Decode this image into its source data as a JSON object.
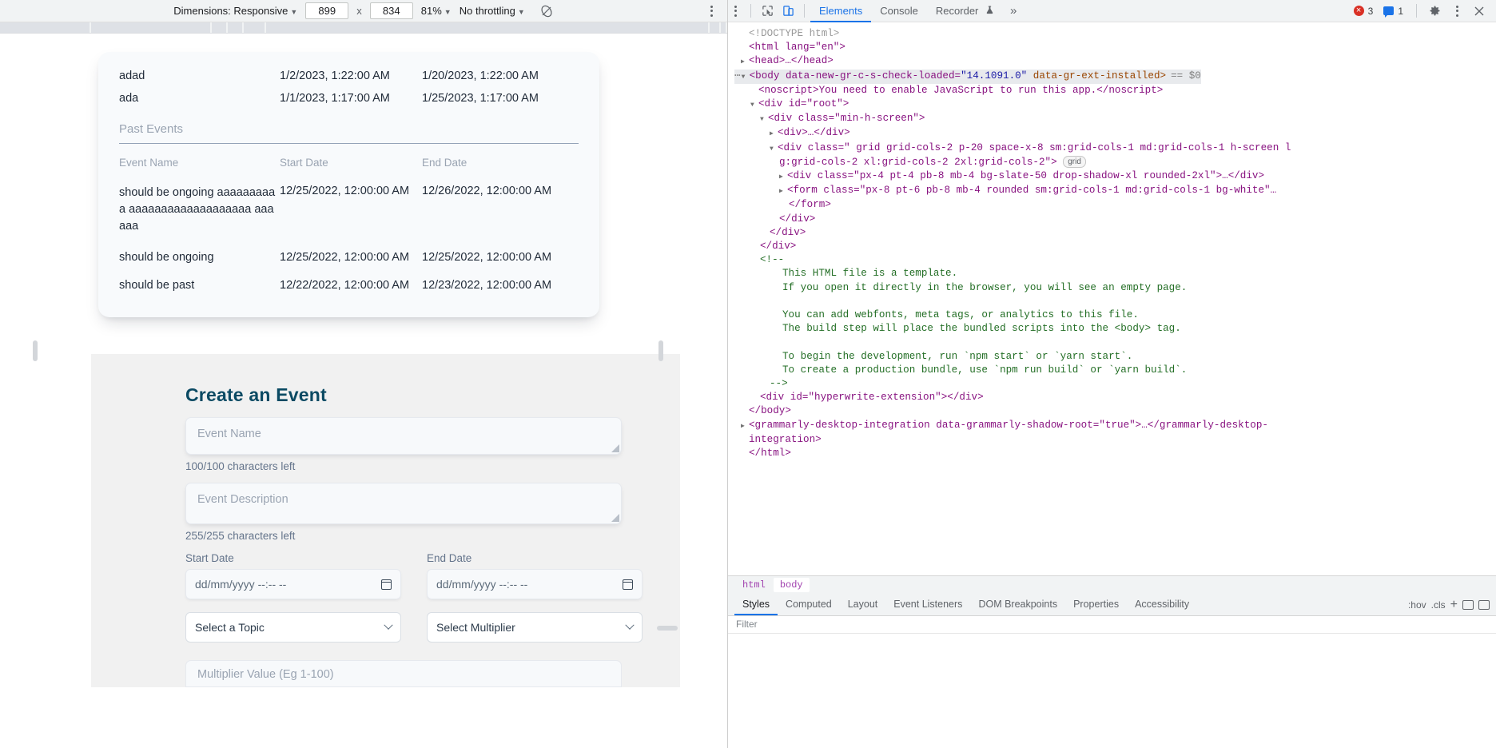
{
  "emulation_toolbar": {
    "dimensions_label": "Dimensions: Responsive",
    "width_value": "899",
    "height_value": "834",
    "multiply": "x",
    "zoom_value": "81%",
    "throttling_value": "No throttling",
    "rotate_icon": "rotate-device-icon",
    "kebab_icon": "more-options-icon"
  },
  "page": {
    "events_card": {
      "top_rows": [
        {
          "name": "adad",
          "start": "1/2/2023, 1:22:00 AM",
          "end": "1/20/2023, 1:22:00 AM"
        },
        {
          "name": "ada",
          "start": "1/1/2023, 1:17:00 AM",
          "end": "1/25/2023, 1:17:00 AM"
        }
      ],
      "section_title": "Past Events",
      "columns": [
        "Event Name",
        "Start Date",
        "End Date"
      ],
      "past_rows": [
        {
          "name": "should be ongoing aaaaaaaaaa aaaaaaaaaaaaaaaaaaa aaaaaa",
          "start": "12/25/2022, 12:00:00 AM",
          "end": "12/26/2022, 12:00:00 AM"
        },
        {
          "name": "should be ongoing",
          "start": "12/25/2022, 12:00:00 AM",
          "end": "12/25/2022, 12:00:00 AM"
        },
        {
          "name": "should be past",
          "start": "12/22/2022, 12:00:00 AM",
          "end": "12/23/2022, 12:00:00 AM"
        }
      ]
    },
    "form": {
      "title": "Create an Event",
      "name_placeholder": "Event Name",
      "name_counter": "100/100 characters left",
      "description_placeholder": "Event Description",
      "description_counter": "255/255 characters left",
      "start_date_label": "Start Date",
      "start_date_placeholder": "dd/mm/yyyy --:-- --",
      "end_date_label": "End Date",
      "end_date_placeholder": "dd/mm/yyyy --:-- --",
      "topic_select_value": "Select a Topic",
      "multiplier_select_value": "Select Multiplier",
      "multiplier_value_placeholder": "Multiplier Value (Eg 1-100)"
    }
  },
  "devtools": {
    "inspect_icon": "inspect-element-icon",
    "device_toolbar_icon": "device-toolbar-icon",
    "tabs": [
      {
        "label": "Elements",
        "selected": true
      },
      {
        "label": "Console",
        "selected": false
      },
      {
        "label": "Recorder",
        "selected": false,
        "icon": "flask-icon"
      }
    ],
    "overflow_label": "»",
    "errors_count": "3",
    "messages_count": "1",
    "settings_icon": "gear-icon",
    "kebab_icon": "more-tools-icon",
    "close_icon": "close-icon",
    "dom": {
      "doctype": "<!DOCTYPE html>",
      "html_open": "<html lang=\"en\">",
      "head": "<head>…</head>",
      "body_open_1": "<body data-new-gr-c-s-check-loaded=",
      "body_version": "\"14.1091.0\"",
      "body_open_2": " data-gr-ext-installed>",
      "body_selected_marker": "== $0",
      "noscript": "<noscript>You need to enable JavaScript to run this app.</noscript>",
      "root_div": "<div id=\"root\">",
      "minh_div": "<div class=\"min-h-screen\">",
      "collapsed_div": "<div>…</div>",
      "grid_div_line1": "<div class=\" grid grid-cols-2 p-20 space-x-8 sm:grid-cols-1 md:grid-cols-1 h-screen l",
      "grid_div_line2": "g:grid-cols-2 xl:grid-cols-2 2xl:grid-cols-2\">",
      "grid_badge": "grid",
      "slate_div": "<div class=\"px-4 pt-4 pb-8 mb-4 bg-slate-50 drop-shadow-xl rounded-2xl\">…</div>",
      "form_line": "<form class=\"px-8 pt-6 pb-8 mb-4 rounded sm:grid-cols-1 md:grid-cols-1 bg-white\"…",
      "form_close": "</form>",
      "close_div_1": "</div>",
      "close_div_2": "</div>",
      "close_div_3": "</div>",
      "comment_open": "<!--",
      "comment_lines": [
        "This HTML file is a template.",
        "If you open it directly in the browser, you will see an empty page.",
        "",
        "You can add webfonts, meta tags, or analytics to this file.",
        "The build step will place the bundled scripts into the <body> tag.",
        "",
        "To begin the development, run `npm start` or `yarn start`.",
        "To create a production bundle, use `npm run build` or `yarn build`."
      ],
      "comment_close": "-->",
      "hyperwrite_div": "<div id=\"hyperwrite-extension\"></div>",
      "body_close": "</body>",
      "grammarly_1": "<grammarly-desktop-integration data-grammarly-shadow-root=\"true\">…</grammarly-desktop-",
      "grammarly_2": "integration>",
      "html_close": "</html>"
    },
    "breadcrumb": [
      "html",
      "body"
    ],
    "style_tabs": [
      {
        "label": "Styles",
        "selected": true
      },
      {
        "label": "Computed",
        "selected": false
      },
      {
        "label": "Layout",
        "selected": false
      },
      {
        "label": "Event Listeners",
        "selected": false
      },
      {
        "label": "DOM Breakpoints",
        "selected": false
      },
      {
        "label": "Properties",
        "selected": false
      },
      {
        "label": "Accessibility",
        "selected": false
      }
    ],
    "filter_placeholder": "Filter",
    "hov_label": ":hov",
    "cls_label": ".cls",
    "new_rule_icon": "plus-icon",
    "toggle_element_state_icon": "element-state-icon",
    "colors": {
      "accent": "#1a73e8",
      "error": "#d93025",
      "tag": "#881280",
      "attr_name": "#994500",
      "attr_value": "#1a1aa6",
      "comment": "#236e25"
    }
  }
}
